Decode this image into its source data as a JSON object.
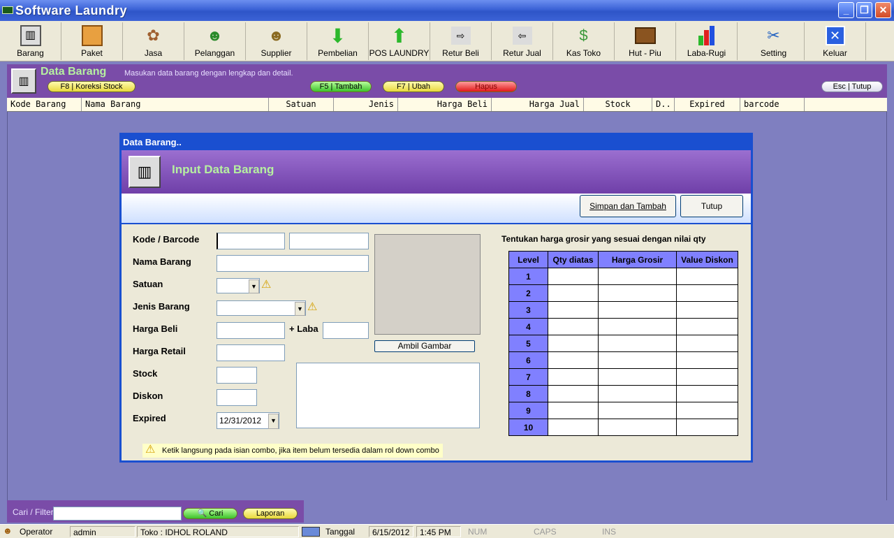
{
  "window": {
    "title": "Software Laundry"
  },
  "toolbar": [
    {
      "label": "Barang",
      "icon": "box-icon"
    },
    {
      "label": "Paket",
      "icon": "package-icon"
    },
    {
      "label": "Jasa",
      "icon": "service-icon"
    },
    {
      "label": "Pelanggan",
      "icon": "customer-icon"
    },
    {
      "label": "Supplier",
      "icon": "supplier-icon"
    },
    {
      "label": "Pembelian",
      "icon": "arrow-down-icon"
    },
    {
      "label": "POS LAUNDRY",
      "icon": "arrow-up-icon"
    },
    {
      "label": "Retur Beli",
      "icon": "arrow-right-icon"
    },
    {
      "label": "Retur Jual",
      "icon": "arrow-left-icon"
    },
    {
      "label": "Kas Toko",
      "icon": "money-icon"
    },
    {
      "label": "Hut - Piu",
      "icon": "briefcase-icon"
    },
    {
      "label": "Laba-Rugi",
      "icon": "bar-chart-icon"
    },
    {
      "label": "Setting",
      "icon": "tools-icon"
    },
    {
      "label": "Keluar",
      "icon": "close-icon"
    }
  ],
  "panel": {
    "title": "Data Barang",
    "subtitle": "Masukan data barang dengan lengkap dan detail.",
    "btn_koreksi": "F8 | Koreksi Stock",
    "btn_tambah": "F5 | Tambah",
    "btn_ubah": "F7 | Ubah",
    "btn_hapus": "Hapus",
    "btn_tutup": "Esc | Tutup"
  },
  "columns": [
    "Kode Barang",
    "Nama Barang",
    "Satuan",
    "Jenis",
    "Harga Beli",
    "Harga Jual",
    "Stock",
    "D..",
    "Expired",
    "barcode"
  ],
  "dialog": {
    "window_title": "Data Barang..",
    "title": "Input Data Barang",
    "btn_simpan": "Simpan dan Tambah",
    "btn_tutup": "Tutup",
    "labels": {
      "kode": "Kode / Barcode",
      "nama": "Nama Barang",
      "satuan": "Satuan",
      "jenis": "Jenis Barang",
      "harga_beli": "Harga Beli",
      "laba": "+ Laba",
      "harga_retail": "Harga Retail",
      "stock": "Stock",
      "diskon": "Diskon",
      "expired": "Expired"
    },
    "expired_value": "12/31/2012",
    "btn_gambar": "Ambil Gambar",
    "grosir_title": "Tentukan harga grosir yang sesuai dengan nilai qty",
    "grosir_headers": [
      "Level",
      "Qty diatas",
      "Harga Grosir",
      "Value Diskon"
    ],
    "levels": [
      "1",
      "2",
      "3",
      "4",
      "5",
      "6",
      "7",
      "8",
      "9",
      "10"
    ],
    "note": "Ketik langsung pada isian combo, jika item belum tersedia dalam rol down combo"
  },
  "filter": {
    "label": "Cari / Filter",
    "btn_cari": "Cari",
    "btn_laporan": "Laporan"
  },
  "status": {
    "role_label": "Operator",
    "user": "admin",
    "toko": "Toko : IDHOL ROLAND",
    "tanggal_label": "Tanggal",
    "date": "6/15/2012",
    "time": "1:45 PM",
    "num": "NUM",
    "caps": "CAPS",
    "ins": "INS"
  }
}
